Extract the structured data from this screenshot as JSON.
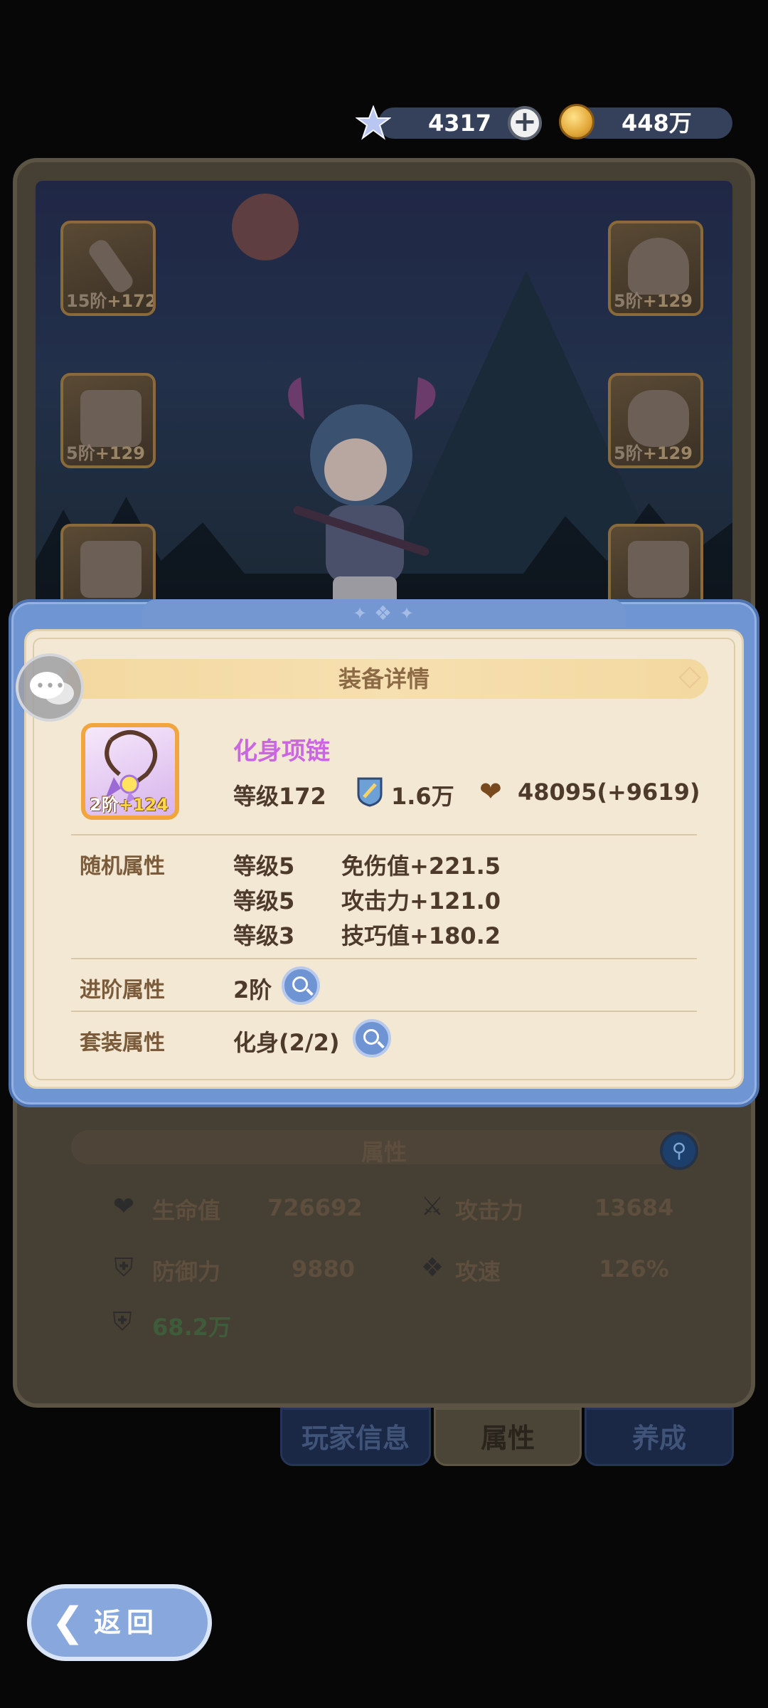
{
  "currency": {
    "gems": "4317",
    "gems_add_label": "+",
    "gold": "448万"
  },
  "equipment_slots": [
    {
      "level_text": "15阶",
      "bonus": "+172"
    },
    {
      "level_text": "5阶",
      "bonus": "+129"
    },
    {
      "level_text": "5阶",
      "bonus": "+129"
    },
    {
      "level_text": "5阶",
      "bonus": "+129"
    },
    {
      "level_text": "",
      "bonus": ""
    },
    {
      "level_text": "",
      "bonus": ""
    }
  ],
  "modal": {
    "title": "装备详情",
    "item": {
      "name": "化身项链",
      "tier": "2阶",
      "bonus": "+124",
      "level": "等级172",
      "power": "1.6万",
      "hp": "48095(+9619)"
    },
    "random_attributes": {
      "label": "随机属性",
      "rows": [
        {
          "level": "等级5",
          "stat": "免伤值+221.5"
        },
        {
          "level": "等级5",
          "stat": "攻击力+121.0"
        },
        {
          "level": "等级3",
          "stat": "技巧值+180.2"
        }
      ]
    },
    "advance_attributes": {
      "label": "进阶属性",
      "value": "2阶"
    },
    "set_attributes": {
      "label": "套装属性",
      "value": "化身(2/2)"
    }
  },
  "stats_panel": {
    "title": "属性",
    "hp_label": "生命值",
    "hp_value": "726692",
    "atk_label": "攻击力",
    "atk_value": "13684",
    "def_label": "防御力",
    "def_value": "9880",
    "spd_label": "攻速",
    "spd_value": "126%",
    "power_value": "68.2万"
  },
  "tabs": [
    "玩家信息",
    "属性",
    "养成"
  ],
  "back_button": "返回",
  "colors": {
    "modal_blue": "#7095d3",
    "modal_cream": "#f2e8d4",
    "item_name": "#cb66e1",
    "title_banner": "#f3d8a0"
  }
}
